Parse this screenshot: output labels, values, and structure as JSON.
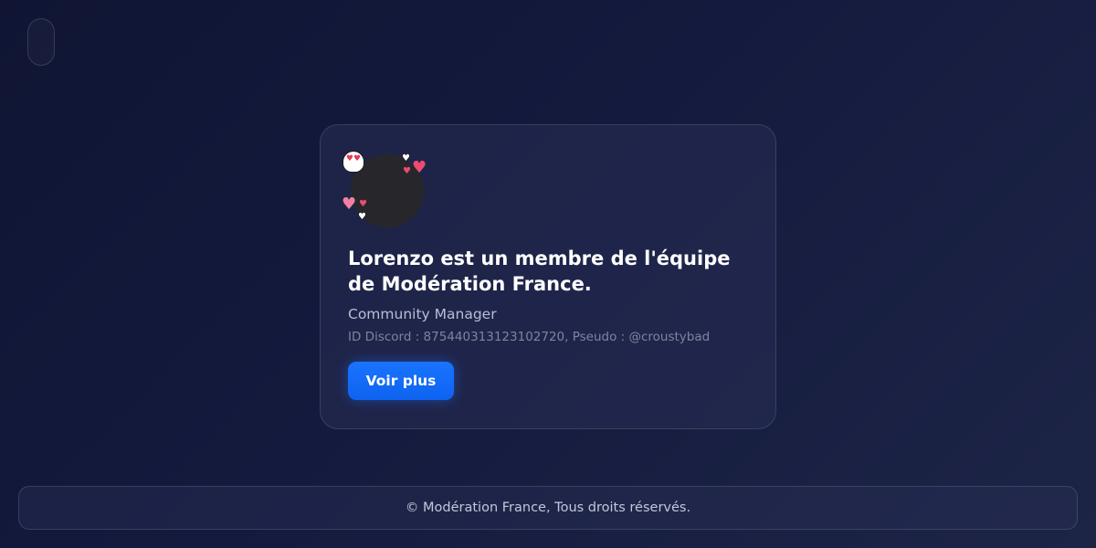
{
  "profile": {
    "title": "Lorenzo est un membre de l'équipe de Modération France.",
    "role": "Community Manager",
    "ids": "ID Discord : 875440313123102720, Pseudo : @croustybad",
    "button_label": "Voir plus"
  },
  "footer": {
    "text": "© Modération France, Tous droits réservés."
  },
  "icons": {
    "ghost": "ghost-love-icon",
    "hearts": "heart-icon"
  },
  "colors": {
    "accent": "#1a74ff",
    "background": "#141a3d"
  }
}
